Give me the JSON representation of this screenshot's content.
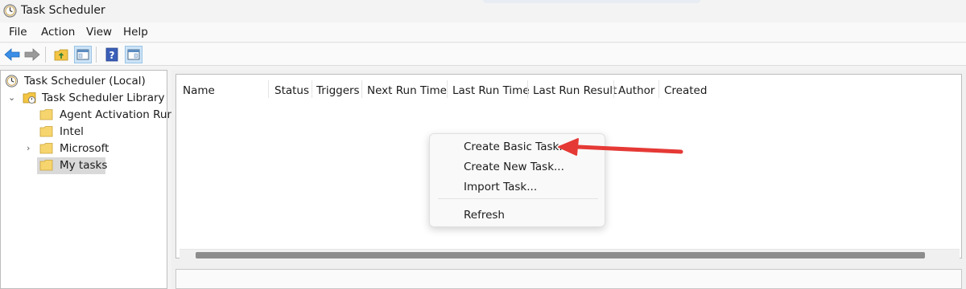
{
  "window": {
    "title": "Task Scheduler",
    "icon": "clock-icon"
  },
  "menu": [
    "File",
    "Action",
    "View",
    "Help"
  ],
  "toolbar": {
    "buttons": [
      "back-icon",
      "forward-icon",
      "up-folder-icon",
      "show-hide-console-tree-icon",
      "help-icon",
      "show-hide-action-pane-icon"
    ]
  },
  "tree": {
    "root": "Task Scheduler (Local)",
    "library": "Task Scheduler Library",
    "children": [
      "Agent Activation Runt",
      "Intel",
      "Microsoft",
      "My tasks"
    ],
    "selected": "My tasks"
  },
  "table": {
    "columns": [
      "Name",
      "Status",
      "Triggers",
      "Next Run Time",
      "Last Run Time",
      "Last Run Result",
      "Author",
      "Created"
    ]
  },
  "context_menu": {
    "items": [
      "Create Basic Task...",
      "Create New Task...",
      "Import Task...",
      "Refresh"
    ]
  },
  "colors": {
    "arrow": "#e53935",
    "selection": "#d9d9d9",
    "scroll_thumb": "#8c8c8c"
  }
}
